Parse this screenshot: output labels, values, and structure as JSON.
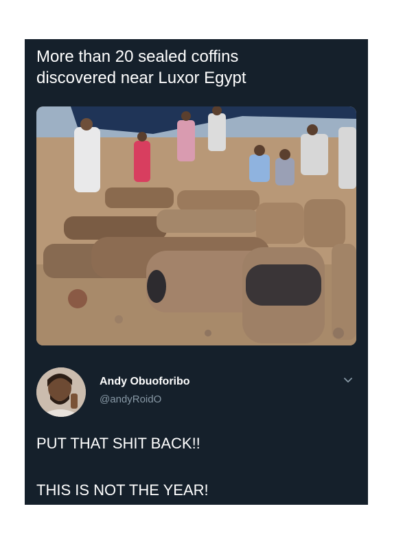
{
  "post": {
    "headline_line1": "More than 20 sealed coffins",
    "headline_line2": "discovered near Luxor Egypt"
  },
  "tweet": {
    "display_name": "Andy Obuoforibo",
    "handle": "@andyRoidO",
    "text_line1": "PUT THAT SHIT BACK!!",
    "text_line2": "THIS IS NOT THE YEAR!"
  },
  "icons": {
    "menu": "chevron-down-icon"
  },
  "colors": {
    "card_background": "#15202b",
    "primary_text": "#ffffff",
    "secondary_text": "#8899a6"
  }
}
